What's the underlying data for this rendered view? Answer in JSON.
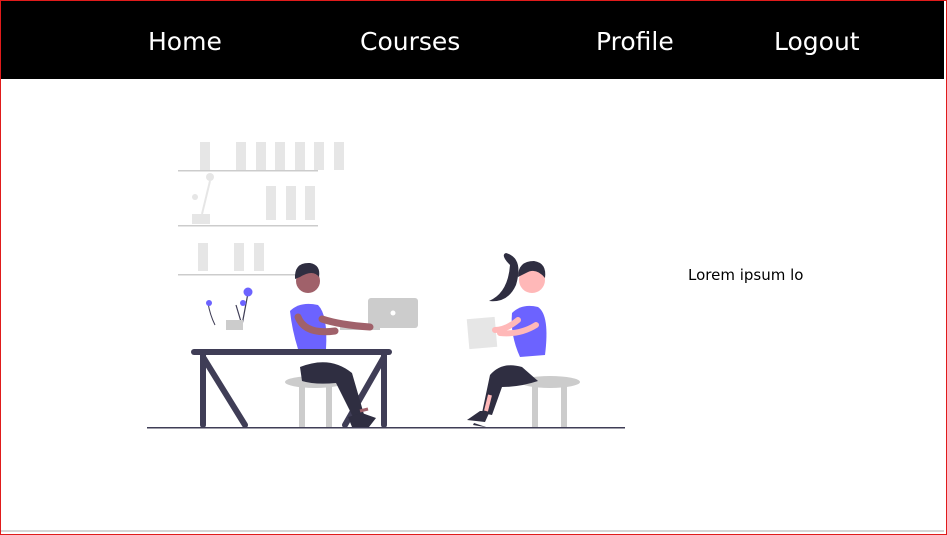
{
  "nav": {
    "items": [
      "Home",
      "Courses",
      "Profile",
      "Logout"
    ]
  },
  "main": {
    "text": "Lorem ipsum lo"
  },
  "colors": {
    "accent": "#6c63ff",
    "navbar_bg": "#000000",
    "border": "#e01b1b"
  },
  "illustration": {
    "icon": "meeting-people-illustration"
  }
}
